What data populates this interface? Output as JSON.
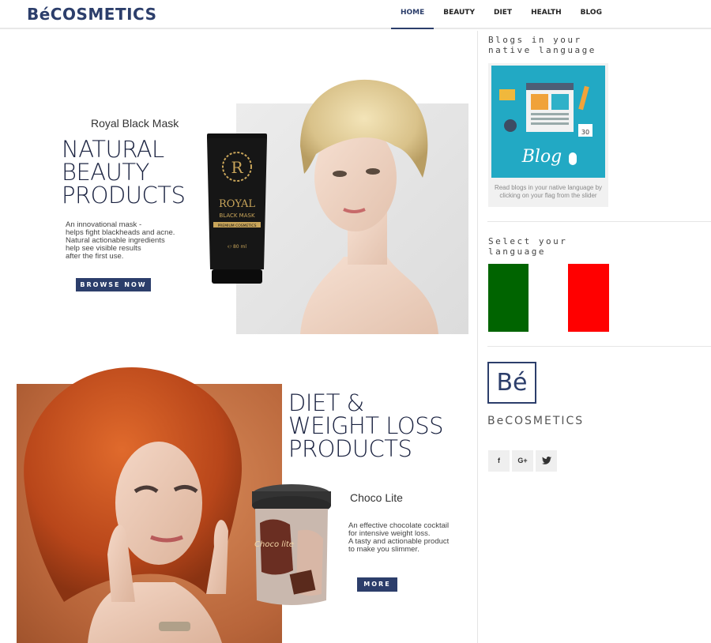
{
  "header": {
    "logo": "BéCOSMETICS",
    "nav": [
      {
        "label": "HOME",
        "active": true
      },
      {
        "label": "BEAUTY",
        "active": false
      },
      {
        "label": "DIET",
        "active": false
      },
      {
        "label": "HEALTH",
        "active": false
      },
      {
        "label": "BLOG",
        "active": false
      }
    ]
  },
  "hero1": {
    "subtitle": "Royal Black Mask",
    "title_lines": [
      "NATURAL",
      "BEAUTY",
      "PRODUCTS"
    ],
    "description_lines": [
      "An innovational mask -",
      "helps fight blackheads and acne.",
      "Natural actionable ingredients",
      "help see visible results",
      "after the first use."
    ],
    "button": "BROWSE NOW",
    "tube_text": {
      "brand": "ROYAL",
      "product": "BLACK MASK",
      "line": "PREMIUM COSMETICS",
      "volume": "℮ 80 ml",
      "monogram": "R"
    }
  },
  "hero2": {
    "title_lines": [
      "DIET &",
      "WEIGHT LOSS",
      "PRODUCTS"
    ],
    "subtitle": "Choco Lite",
    "description_lines": [
      "An effective chocolate cocktail",
      "for intensive weight loss.",
      "A tasty and actionable product",
      "to make you slimmer."
    ],
    "button": "MORE",
    "tin_text": "Choco lite"
  },
  "sidebar": {
    "blogs_title": "Blogs in your native language",
    "blog_image_text": "Blog",
    "blog_caption_lines": [
      "Read blogs in your native language by",
      "clicking on your flag from the slider"
    ],
    "language_title": "Select your language",
    "flag_colors": [
      "#006400",
      "#ffffff",
      "#ff0000"
    ],
    "brand_mark": "Bé",
    "brand_name": "BeCOSMETICS",
    "social": [
      {
        "icon": "facebook-icon",
        "glyph": "f"
      },
      {
        "icon": "google-plus-icon",
        "glyph": "G+"
      },
      {
        "icon": "twitter-icon",
        "glyph": "🐦"
      }
    ]
  }
}
